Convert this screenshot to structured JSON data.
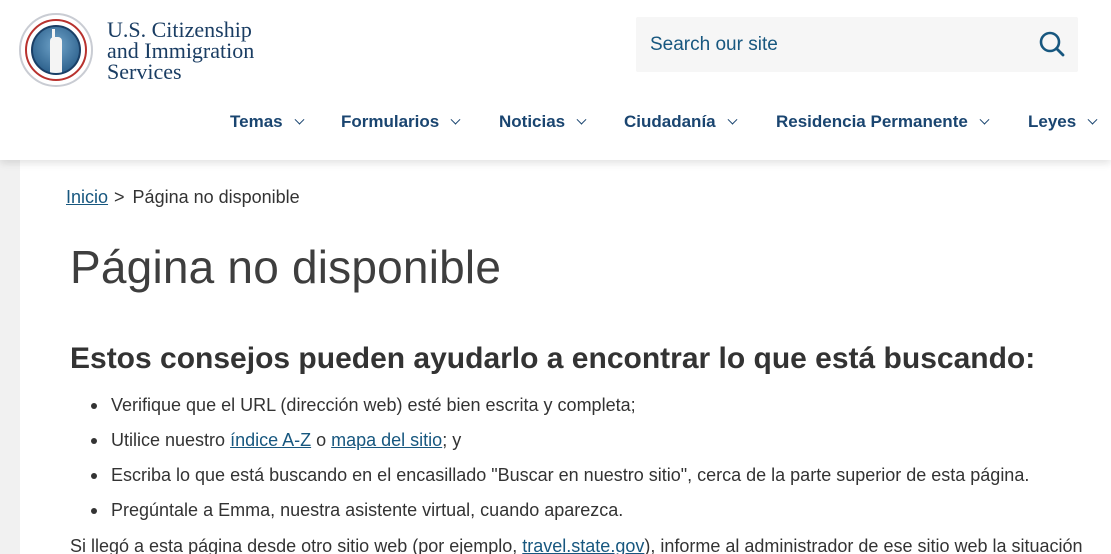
{
  "header": {
    "logo": {
      "line1": "U.S. Citizenship",
      "line2": "and Immigration",
      "line3": "Services"
    },
    "search": {
      "placeholder": "Search our site",
      "value": ""
    },
    "nav": [
      {
        "label": "Temas"
      },
      {
        "label": "Formularios"
      },
      {
        "label": "Noticias"
      },
      {
        "label": "Ciudadanía"
      },
      {
        "label": "Residencia Permanente"
      },
      {
        "label": "Leyes"
      }
    ]
  },
  "breadcrumb": {
    "home": "Inicio",
    "separator": ">",
    "current": "Página no disponible"
  },
  "page": {
    "title": "Página no disponible",
    "subtitle": "Estos consejos pueden ayudarlo a encontrar lo que está buscando:",
    "tips": {
      "t1": "Verifique que el URL (dirección web) esté bien escrita y completa;",
      "t2_prefix": "Utilice nuestro ",
      "t2_link1": "índice A-Z",
      "t2_mid": " o ",
      "t2_link2": "mapa del sitio",
      "t2_suffix": "; y",
      "t3": "Escriba lo que está buscando en el encasillado \"Buscar en nuestro sitio\", cerca de la parte superior de esta página.",
      "t4": "Pregúntale a Emma, nuestra asistente virtual, cuando aparezca."
    },
    "note": {
      "prefix": "Si llegó a esta página desde otro sitio web (por ejemplo, ",
      "link": "travel.state.gov",
      "suffix": "), informe al administrador de ese sitio web la situación"
    }
  }
}
